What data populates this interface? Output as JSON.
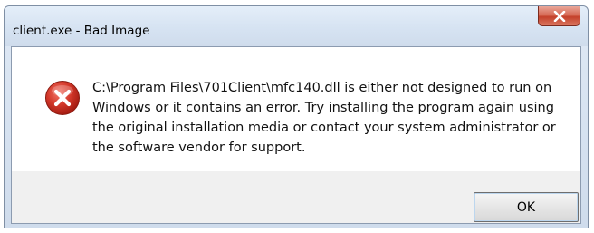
{
  "window": {
    "title": "client.exe - Bad Image"
  },
  "icons": {
    "error": "error-icon",
    "close": "close-icon"
  },
  "message": {
    "lines": [
      "C:\\Program Files\\701Client\\mfc140.dll is either not designed to run on",
      "Windows or it contains an error. Try installing the program again using",
      "the original installation media or contact your system administrator or",
      "the software vendor for support."
    ]
  },
  "buttons": {
    "ok_label": "OK"
  },
  "colors": {
    "close_button": "#c4412a",
    "error_icon": "#c8281e"
  }
}
